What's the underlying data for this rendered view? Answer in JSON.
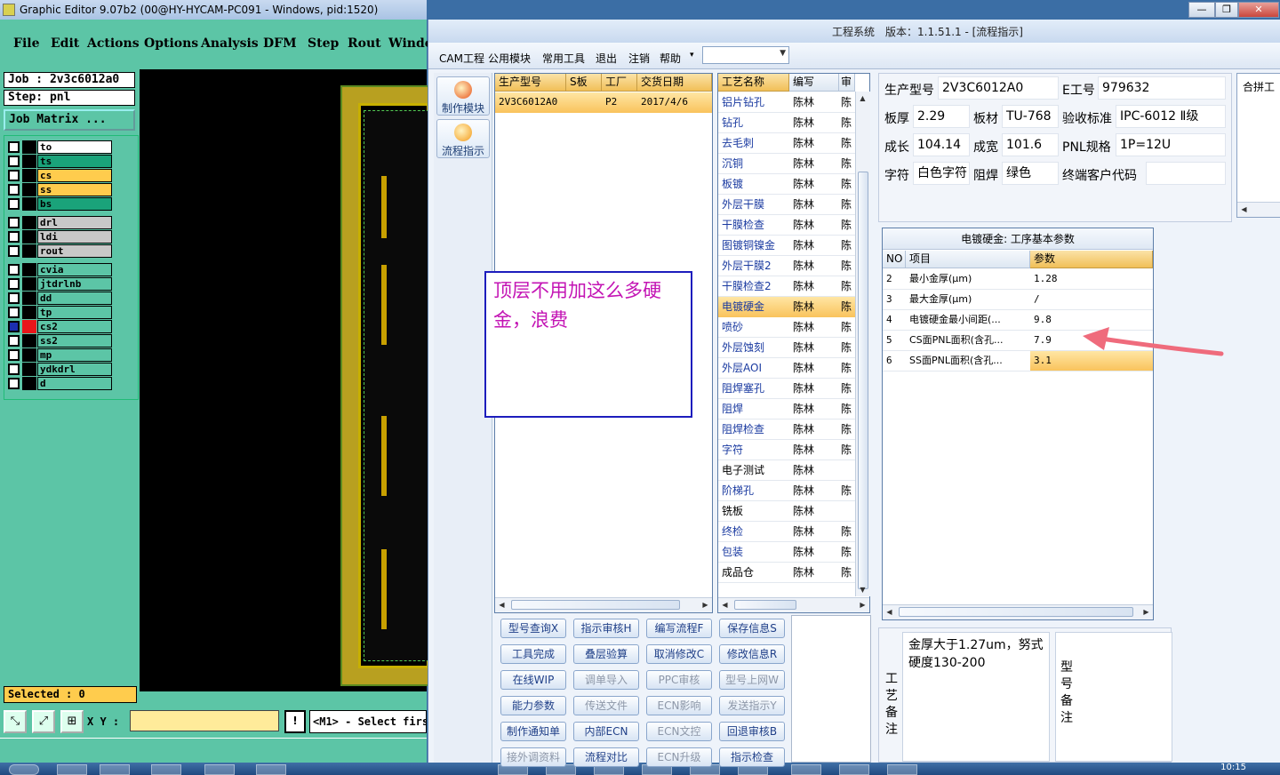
{
  "ge": {
    "title": "Graphic Editor 9.07b2 (00@HY-HYCAM-PC091 - Windows, pid:1520)",
    "menu": [
      "File",
      "Edit",
      "Actions",
      "Options",
      "Analysis",
      "DFM",
      "Step",
      "Rout",
      "Window"
    ],
    "job": "Job : 2v3c6012a0",
    "step": "Step: pnl",
    "job_matrix": "Job Matrix ...",
    "layers": [
      {
        "name": "to",
        "color": "#ffffff"
      },
      {
        "name": "ts",
        "color": "#1aa37a"
      },
      {
        "name": "cs",
        "color": "#ffcc4d"
      },
      {
        "name": "ss",
        "color": "#ffcc4d"
      },
      {
        "name": "bs",
        "color": "#1aa37a"
      },
      {
        "name": "drl",
        "color": "#c8c8c8"
      },
      {
        "name": "ldi",
        "color": "#c8c8c8"
      },
      {
        "name": "rout",
        "color": "#c8c8c8"
      },
      {
        "name": "cvia",
        "color": "#5cc5a6"
      },
      {
        "name": "jtdrlnb",
        "color": "#5cc5a6"
      },
      {
        "name": "dd",
        "color": "#5cc5a6"
      },
      {
        "name": "tp",
        "color": "#5cc5a6"
      },
      {
        "name": "cs2",
        "color": "#5cc5a6"
      },
      {
        "name": "ss2",
        "color": "#5cc5a6"
      },
      {
        "name": "mp",
        "color": "#5cc5a6"
      },
      {
        "name": "ydkdrl",
        "color": "#5cc5a6"
      },
      {
        "name": "d",
        "color": "#5cc5a6"
      }
    ],
    "selected": "Selected : 0",
    "xy_label": "X Y :",
    "status": "<M1> - Select first"
  },
  "win": {
    "title": "工程系统　版本：1.1.51.1 - [流程指示]",
    "ctrl": [
      "—",
      "❐",
      "✕"
    ],
    "menu": [
      "CAM工程",
      "公用模块",
      "常用工具",
      "退出",
      "注销",
      "帮助"
    ],
    "nav": [
      {
        "label": "制作模块",
        "color": "#e8521a"
      },
      {
        "label": "流程指示",
        "color": "#f39a1a"
      }
    ],
    "orders": {
      "headers": [
        "生产型号",
        "S板",
        "工厂",
        "交货日期"
      ],
      "rows": [
        [
          "2V3C6012A0",
          "",
          "P2",
          "2017/4/6"
        ]
      ]
    },
    "process": {
      "headers": [
        "工艺名称",
        "编写",
        "审"
      ],
      "rows": [
        [
          "铝片钻孔",
          "陈林",
          "陈"
        ],
        [
          "钻孔",
          "陈林",
          "陈"
        ],
        [
          "去毛刺",
          "陈林",
          "陈"
        ],
        [
          "沉铜",
          "陈林",
          "陈"
        ],
        [
          "板镀",
          "陈林",
          "陈"
        ],
        [
          "外层干膜",
          "陈林",
          "陈"
        ],
        [
          "干膜检查",
          "陈林",
          "陈"
        ],
        [
          "图镀铜镍金",
          "陈林",
          "陈"
        ],
        [
          "外层干膜2",
          "陈林",
          "陈"
        ],
        [
          "干膜检查2",
          "陈林",
          "陈"
        ],
        [
          "电镀硬金",
          "陈林",
          "陈"
        ],
        [
          "喷砂",
          "陈林",
          "陈"
        ],
        [
          "外层蚀刻",
          "陈林",
          "陈"
        ],
        [
          "外层AOI",
          "陈林",
          "陈"
        ],
        [
          "阻焊塞孔",
          "陈林",
          "陈"
        ],
        [
          "阻焊",
          "陈林",
          "陈"
        ],
        [
          "阻焊检查",
          "陈林",
          "陈"
        ],
        [
          "字符",
          "陈林",
          "陈"
        ],
        [
          "电子测试",
          "陈林",
          ""
        ],
        [
          "阶梯孔",
          "陈林",
          "陈"
        ],
        [
          "铣板",
          "陈林",
          ""
        ],
        [
          "终检",
          "陈林",
          "陈"
        ],
        [
          "包装",
          "陈林",
          "陈"
        ],
        [
          "成品仓",
          "陈林",
          "陈"
        ]
      ]
    },
    "info": {
      "model_label": "生产型号",
      "model": "2V3C6012A0",
      "e_label": "E工号",
      "e_no": "979632",
      "thick_label": "板厚",
      "thick": "2.29",
      "mat_label": "板材",
      "mat": "TU-768",
      "std_label": "验收标准",
      "std": "IPC-6012 Ⅱ级",
      "len_label": "成长",
      "len": "104.14",
      "wid_label": "成宽",
      "wid": "101.6",
      "pnl_label": "PNL规格",
      "pnl": "1P=12U",
      "char_label": "字符",
      "char": "白色字符",
      "mask_label": "阻焊",
      "mask": "绿色",
      "cust_label": "终端客户代码",
      "cust": ""
    },
    "side_label": "合拼工",
    "params": {
      "title": "电镀硬金: 工序基本参数",
      "headers": [
        "NO",
        "项目",
        "参数"
      ],
      "rows": [
        [
          "2",
          "最小金厚(μm)",
          "1.28"
        ],
        [
          "3",
          "最大金厚(μm)",
          "/"
        ],
        [
          "4",
          "电镀硬金最小间距(...",
          "9.8"
        ],
        [
          "5",
          "CS面PNL面积(含孔...",
          "7.9"
        ],
        [
          "6",
          "SS面PNL面积(含孔...",
          "3.1"
        ]
      ]
    },
    "buttons": [
      [
        "型号查询X",
        "指示审核H",
        "编写流程F",
        "保存信息S"
      ],
      [
        "工具完成",
        "叠层验算",
        "取消修改C",
        "修改信息R"
      ],
      [
        "在线WIP",
        "调单导入",
        "PPC审核",
        "型号上网W"
      ],
      [
        "能力参数",
        "传送文件",
        "ECN影响",
        "发送指示Y"
      ],
      [
        "制作通知单",
        "内部ECN",
        "ECN文控",
        "回退审核B"
      ],
      [
        "接外调资料",
        "流程对比",
        "ECN升级",
        "指示检查"
      ]
    ],
    "remark_label": "工艺备注",
    "remark_text": "金厚大于1.27um，努式硬度130-200",
    "remark2_label": "型号备注"
  },
  "callout": "顶层不用加这么多硬金，浪费",
  "clock": "10:15"
}
